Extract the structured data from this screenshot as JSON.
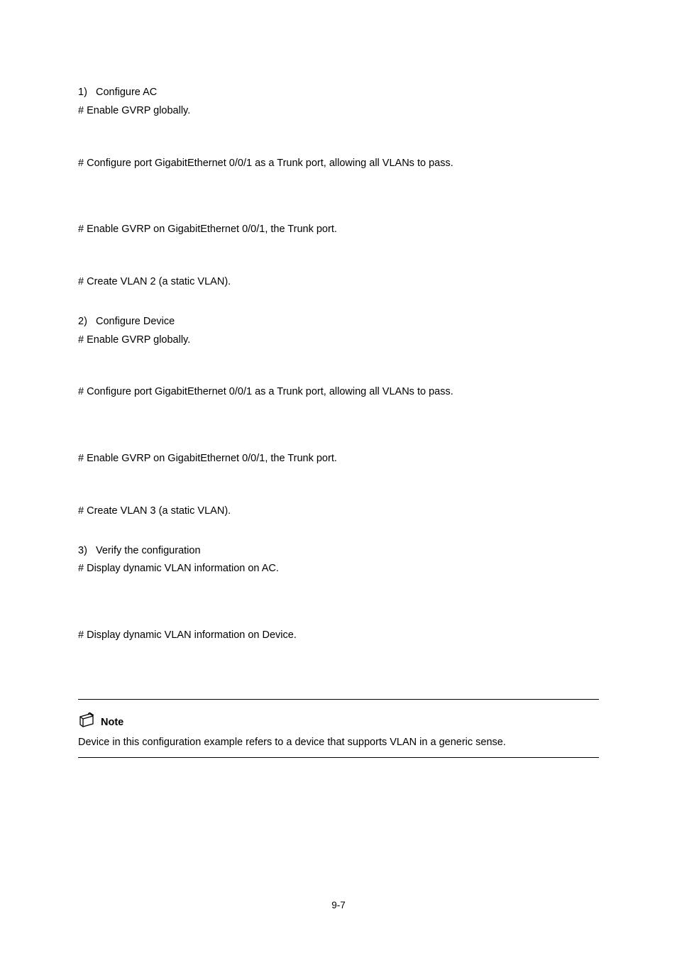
{
  "s1": {
    "num": "1)",
    "title": "Configure AC",
    "l1": "# Enable GVRP globally.",
    "l2": "# Configure port GigabitEthernet 0/0/1 as a Trunk port, allowing all VLANs to pass.",
    "l3": "# Enable GVRP on GigabitEthernet 0/0/1, the Trunk port.",
    "l4": "# Create VLAN 2 (a static VLAN)."
  },
  "s2": {
    "num": "2)",
    "title": "Configure Device",
    "l1": "# Enable GVRP globally.",
    "l2": "# Configure port GigabitEthernet 0/0/1 as a Trunk port, allowing all VLANs to pass.",
    "l3": "# Enable GVRP on GigabitEthernet 0/0/1, the Trunk port.",
    "l4": "# Create VLAN 3 (a static VLAN)."
  },
  "s3": {
    "num": "3)",
    "title": "Verify the configuration",
    "l1": "# Display dynamic VLAN information on AC.",
    "l2": "# Display dynamic VLAN information on Device."
  },
  "note": {
    "label": "Note",
    "body": "Device in this configuration example refers to a device that supports VLAN in a generic sense."
  },
  "page_number": "9-7"
}
